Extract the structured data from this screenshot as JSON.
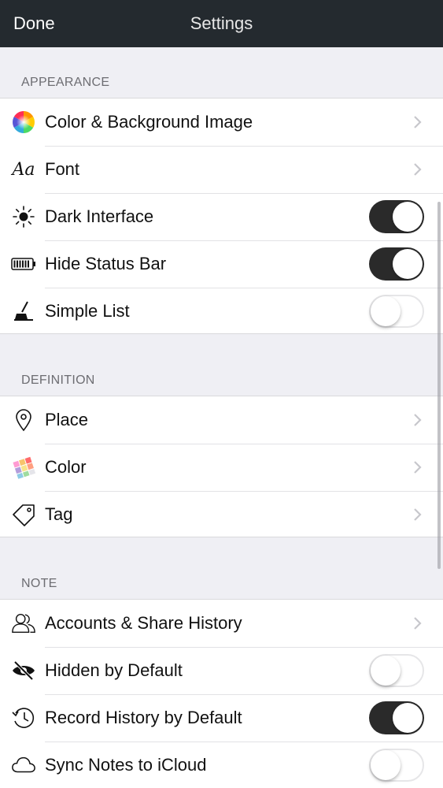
{
  "navbar": {
    "done_label": "Done",
    "title": "Settings"
  },
  "sections": {
    "appearance": {
      "header": "APPEARANCE",
      "rows": [
        {
          "label": "Color & Background Image",
          "icon": "color-wheel-icon",
          "control": "chevron"
        },
        {
          "label": "Font",
          "icon": "font-aa-icon",
          "control": "chevron",
          "icon_text": "Aa"
        },
        {
          "label": "Dark Interface",
          "icon": "brightness-icon",
          "control": "toggle",
          "value": true
        },
        {
          "label": "Hide Status Bar",
          "icon": "battery-icon",
          "control": "toggle",
          "value": true
        },
        {
          "label": "Simple List",
          "icon": "broom-icon",
          "control": "toggle",
          "value": false
        }
      ]
    },
    "definition": {
      "header": "DEFINITION",
      "rows": [
        {
          "label": "Place",
          "icon": "location-pin-icon",
          "control": "chevron"
        },
        {
          "label": "Color",
          "icon": "color-palette-icon",
          "control": "chevron"
        },
        {
          "label": "Tag",
          "icon": "tag-icon",
          "control": "chevron"
        }
      ]
    },
    "note": {
      "header": "NOTE",
      "rows": [
        {
          "label": "Accounts & Share History",
          "icon": "people-icon",
          "control": "chevron"
        },
        {
          "label": "Hidden by Default",
          "icon": "eye-slash-icon",
          "control": "toggle",
          "value": false
        },
        {
          "label": "Record History by Default",
          "icon": "history-clock-icon",
          "control": "toggle",
          "value": true
        },
        {
          "label": "Sync Notes to iCloud",
          "icon": "cloud-icon",
          "control": "toggle",
          "value": false
        }
      ]
    }
  },
  "colors": {
    "navbar_bg": "#242a2f",
    "background": "#efeff4",
    "toggle_on": "#2a2a2a"
  }
}
